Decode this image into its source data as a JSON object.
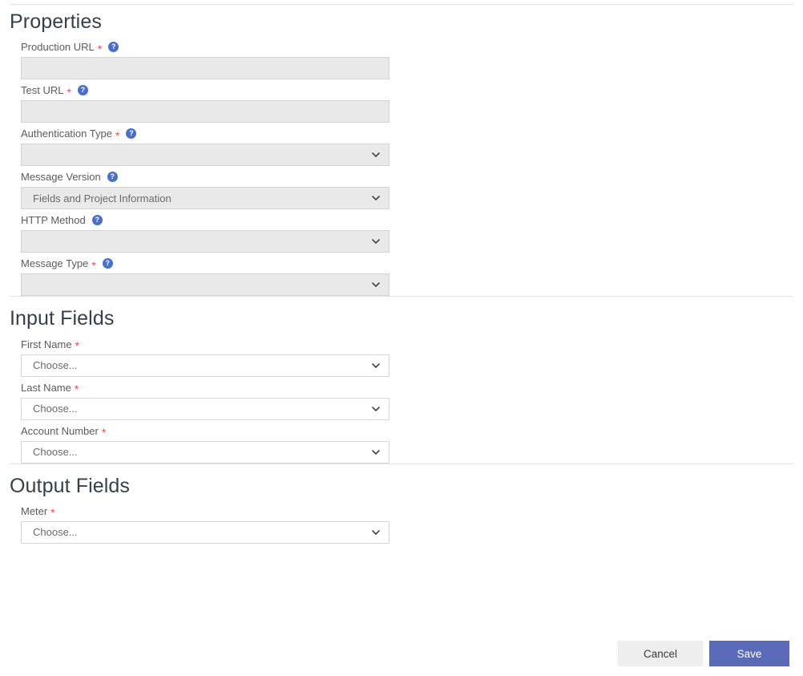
{
  "sections": [
    {
      "id": "properties",
      "title": "Properties",
      "fields": [
        {
          "label": "Production URL",
          "required": true,
          "help": true,
          "control": "text",
          "state": "disabled",
          "value": ""
        },
        {
          "label": "Test URL",
          "required": true,
          "help": true,
          "control": "text",
          "state": "disabled",
          "value": ""
        },
        {
          "label": "Authentication Type",
          "required": true,
          "help": true,
          "control": "select",
          "state": "disabled",
          "value": ""
        },
        {
          "label": "Message Version",
          "required": false,
          "help": true,
          "control": "select",
          "state": "disabled",
          "value": "Fields and Project Information"
        },
        {
          "label": "HTTP Method",
          "required": false,
          "help": true,
          "control": "select",
          "state": "disabled",
          "value": ""
        },
        {
          "label": "Message Type",
          "required": true,
          "help": true,
          "control": "select",
          "state": "disabled",
          "value": ""
        }
      ]
    },
    {
      "id": "input-fields",
      "title": "Input Fields",
      "fields": [
        {
          "label": "First Name",
          "required": true,
          "help": false,
          "control": "select",
          "state": "enabled",
          "value": "Choose..."
        },
        {
          "label": "Last Name",
          "required": true,
          "help": false,
          "control": "select",
          "state": "enabled",
          "value": "Choose..."
        },
        {
          "label": "Account Number",
          "required": true,
          "help": false,
          "control": "select",
          "state": "enabled",
          "value": "Choose..."
        }
      ]
    },
    {
      "id": "output-fields",
      "title": "Output Fields",
      "fields": [
        {
          "label": "Meter",
          "required": true,
          "help": false,
          "control": "select",
          "state": "enabled",
          "value": "Choose..."
        }
      ]
    }
  ],
  "icons": {
    "help_glyph": "?",
    "help_icon_name": "help-question-icon",
    "chevron_icon_name": "chevron-down-icon"
  },
  "required_marker": "*",
  "footer": {
    "cancel_label": "Cancel",
    "save_label": "Save"
  },
  "colors": {
    "save_button": "#5b6ab8",
    "cancel_button": "#eeeeee",
    "required_asterisk": "#d9534f",
    "help_icon": "#4a6fc4",
    "disabled_field": "#e9e9e9",
    "heading": "#36404a",
    "divider": "#e2e2e2"
  }
}
